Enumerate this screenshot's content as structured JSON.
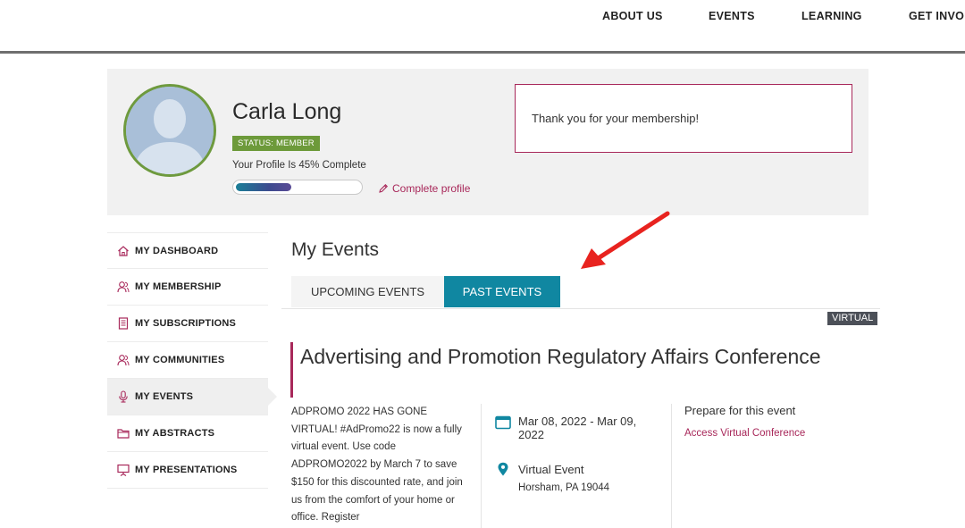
{
  "nav": {
    "items": [
      "ABOUT US",
      "EVENTS",
      "LEARNING",
      "GET INVO"
    ]
  },
  "profile": {
    "name": "Carla Long",
    "status": "STATUS: MEMBER",
    "completion_text": "Your Profile Is 45% Complete",
    "completion_fraction": 0.45,
    "complete_link": "Complete profile",
    "message": "Thank you for your membership!"
  },
  "sidebar": {
    "items": [
      {
        "label": "MY DASHBOARD",
        "icon": "home-icon"
      },
      {
        "label": "MY MEMBERSHIP",
        "icon": "users-icon"
      },
      {
        "label": "MY SUBSCRIPTIONS",
        "icon": "document-icon"
      },
      {
        "label": "MY COMMUNITIES",
        "icon": "users-icon"
      },
      {
        "label": "MY EVENTS",
        "icon": "microphone-icon",
        "active": true
      },
      {
        "label": "MY ABSTRACTS",
        "icon": "folder-icon"
      },
      {
        "label": "MY PRESENTATIONS",
        "icon": "presentation-icon"
      }
    ]
  },
  "main": {
    "title": "My Events",
    "tabs": [
      {
        "label": "UPCOMING EVENTS",
        "active": false
      },
      {
        "label": "PAST EVENTS",
        "active": true
      }
    ]
  },
  "event": {
    "badge": "VIRTUAL",
    "title": "Advertising and Promotion Regulatory Affairs Conference",
    "description": "ADPROMO 2022 HAS GONE VIRTUAL! #AdPromo22 is now a fully virtual event. Use code ADPROMO2022 by March 7 to save $150 for this discounted rate, and join us from the comfort of your home or office. Register",
    "date": "Mar 08, 2022 - Mar 09, 2022",
    "location_title": "Virtual Event",
    "location_address": "Horsham, PA 19044",
    "prepare_title": "Prepare for this event",
    "prepare_link": "Access Virtual Conference"
  },
  "colors": {
    "accent": "#a8285a",
    "tab_active": "#1087a1",
    "status_green": "#6d9a3a",
    "arrow": "#e8231f"
  }
}
